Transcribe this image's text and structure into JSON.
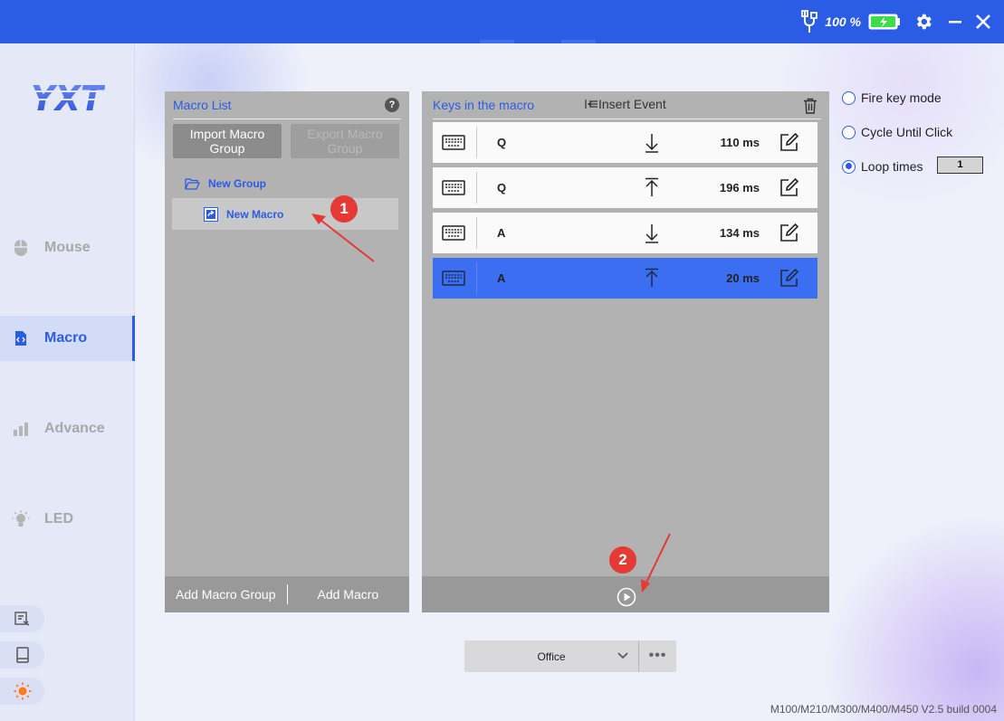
{
  "window": {
    "battery_percent": "100 %",
    "icons": [
      "usb-cable-icon",
      "battery-charging-icon",
      "gear-icon",
      "minimize-icon",
      "close-icon"
    ]
  },
  "sidebar": {
    "logo_text": "YXT",
    "items": [
      {
        "label": "Mouse",
        "icon": "mouse-icon",
        "active": false
      },
      {
        "label": "Macro",
        "icon": "macro-file-icon",
        "active": true
      },
      {
        "label": "Advance",
        "icon": "bar-chart-icon",
        "active": false
      },
      {
        "label": "LED",
        "icon": "light-bulb-icon",
        "active": false
      }
    ],
    "bottom_buttons": [
      "feedback-icon",
      "manual-book-icon",
      "sun-theme-icon"
    ]
  },
  "macro_list": {
    "title": "Macro List",
    "help": "?",
    "import_label": "Import Macro Group",
    "export_label": "Export Macro Group",
    "group_name": "New Group",
    "macro_name": "New Macro",
    "add_group_label": "Add Macro Group",
    "add_macro_label": "Add Macro"
  },
  "keys_panel": {
    "title": "Keys in the macro",
    "insert_event_label": "Insert Event",
    "rows": [
      {
        "key": "Q",
        "direction": "down",
        "delay": "110 ms"
      },
      {
        "key": "Q",
        "direction": "up",
        "delay": "196 ms"
      },
      {
        "key": "A",
        "direction": "down",
        "delay": "134 ms"
      },
      {
        "key": "A",
        "direction": "up",
        "delay": "20 ms",
        "selected": true
      }
    ]
  },
  "options": {
    "fire_key_mode": "Fire key mode",
    "cycle_until_click": "Cycle Until Click",
    "loop_times": "Loop times",
    "loop_value": "1",
    "selected": "loop_times"
  },
  "profile": {
    "name": "Office",
    "more": "•••"
  },
  "version": "M100/M210/M300/M400/M450 V2.5 build 0004",
  "annotations": {
    "badge1": "1",
    "badge2": "2"
  },
  "colors": {
    "accent": "#2b5ce6",
    "selected_row": "#3b6ef0",
    "annotation": "#e53935"
  }
}
